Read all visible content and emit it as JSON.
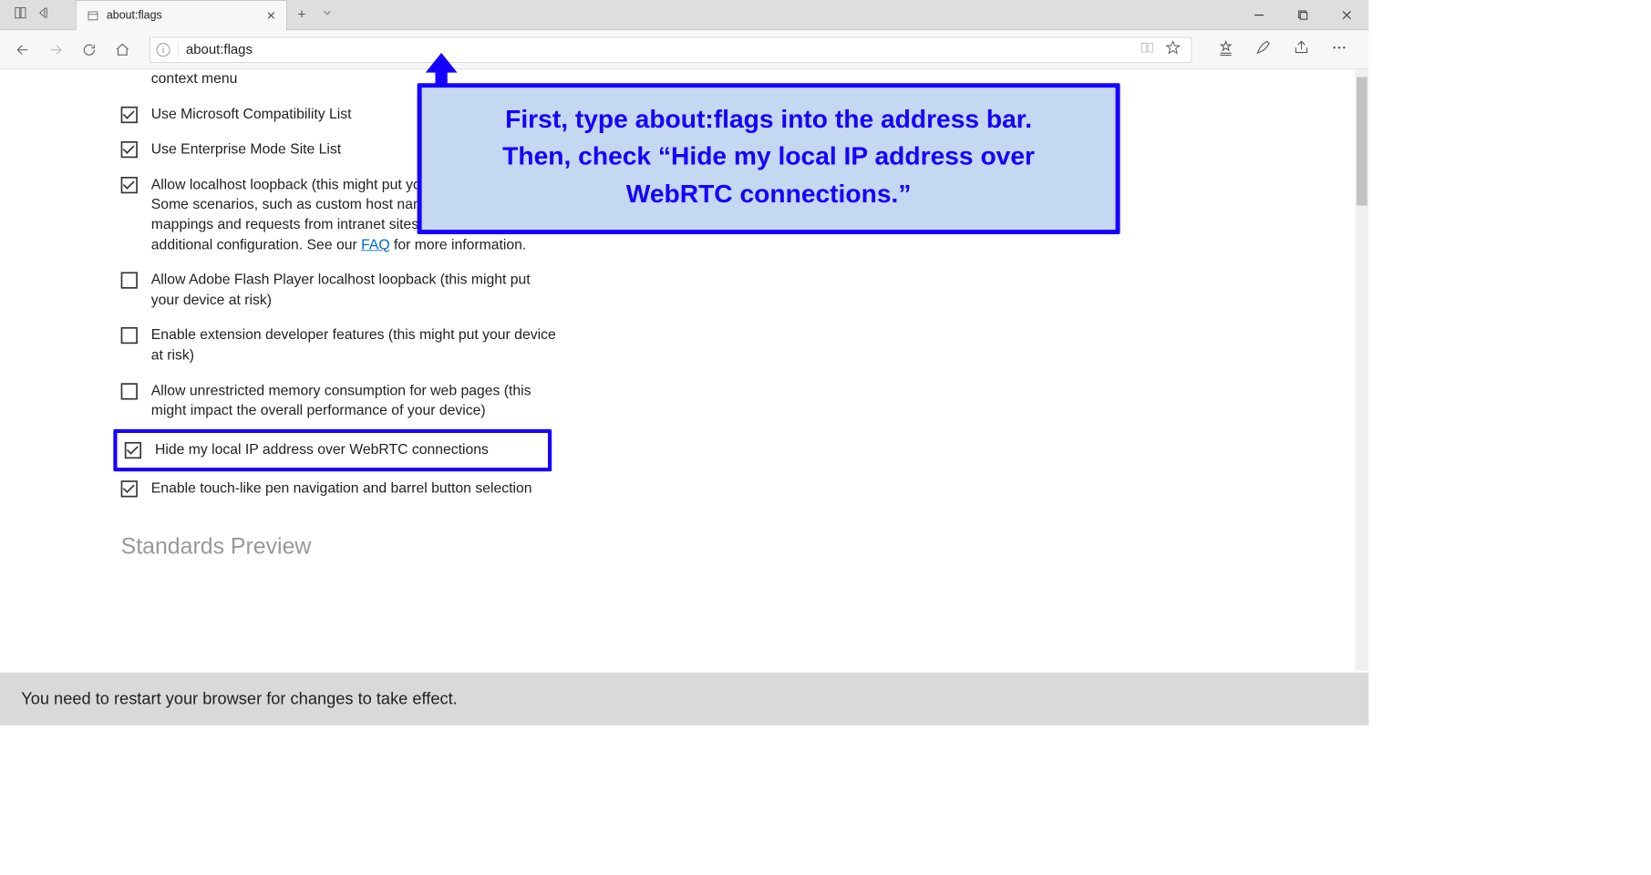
{
  "tab": {
    "title": "about:flags"
  },
  "address": {
    "value": "about:flags"
  },
  "settings": [
    {
      "checked": true,
      "label_pre": "context menu",
      "partial_top": true
    },
    {
      "checked": true,
      "label": "Use Microsoft Compatibility List"
    },
    {
      "checked": true,
      "label": "Use Enterprise Mode Site List"
    },
    {
      "checked": true,
      "label_pre": "Allow localhost loopback (this might put your device at risk). Some scenarios, such as custom host names, custom file mappings and requests from intranet sites, might require additional configuration. See our ",
      "link": "FAQ",
      "label_post": " for more information."
    },
    {
      "checked": false,
      "label": "Allow Adobe Flash Player localhost loopback (this might put your device at risk)"
    },
    {
      "checked": false,
      "label": "Enable extension developer features (this might put your device at risk)"
    },
    {
      "checked": false,
      "label": "Allow unrestricted memory consumption for web pages (this might impact the overall performance of your device)"
    },
    {
      "checked": true,
      "label": "Hide my local IP address over WebRTC connections",
      "highlighted": true
    },
    {
      "checked": true,
      "label": "Enable touch-like pen navigation and barrel button selection"
    }
  ],
  "preview_heading": "Standards Preview",
  "notice": "You need to restart your browser for changes to take effect.",
  "callout": {
    "line1": "First, type about:flags into the address bar.",
    "line2": "Then, check “Hide my local IP address over",
    "line3": "WebRTC connections.”"
  }
}
